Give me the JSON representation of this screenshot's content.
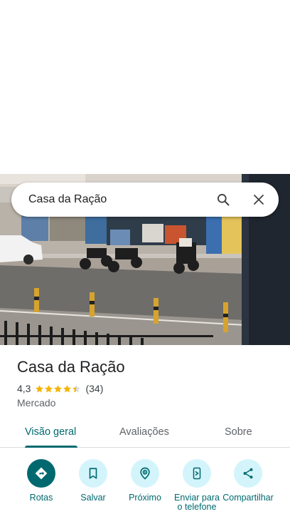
{
  "search": {
    "query": "Casa da Ração"
  },
  "place": {
    "name": "Casa da Ração",
    "rating": "4,3",
    "rating_stars": 4.3,
    "reviews": "(34)",
    "category": "Mercado"
  },
  "tabs": [
    {
      "label": "Visão geral",
      "active": true
    },
    {
      "label": "Avaliações",
      "active": false
    },
    {
      "label": "Sobre",
      "active": false
    }
  ],
  "actions": [
    {
      "label": "Rotas",
      "icon": "directions-icon"
    },
    {
      "label": "Salvar",
      "icon": "bookmark-icon"
    },
    {
      "label": "Próximo",
      "icon": "nearby-icon"
    },
    {
      "label": "Enviar para o telefone",
      "icon": "send-to-phone-icon"
    },
    {
      "label": "Compartilhar",
      "icon": "share-icon"
    }
  ],
  "colors": {
    "accent": "#00696f",
    "action_bg": "#d3f4fb",
    "star": "#f4b400"
  }
}
